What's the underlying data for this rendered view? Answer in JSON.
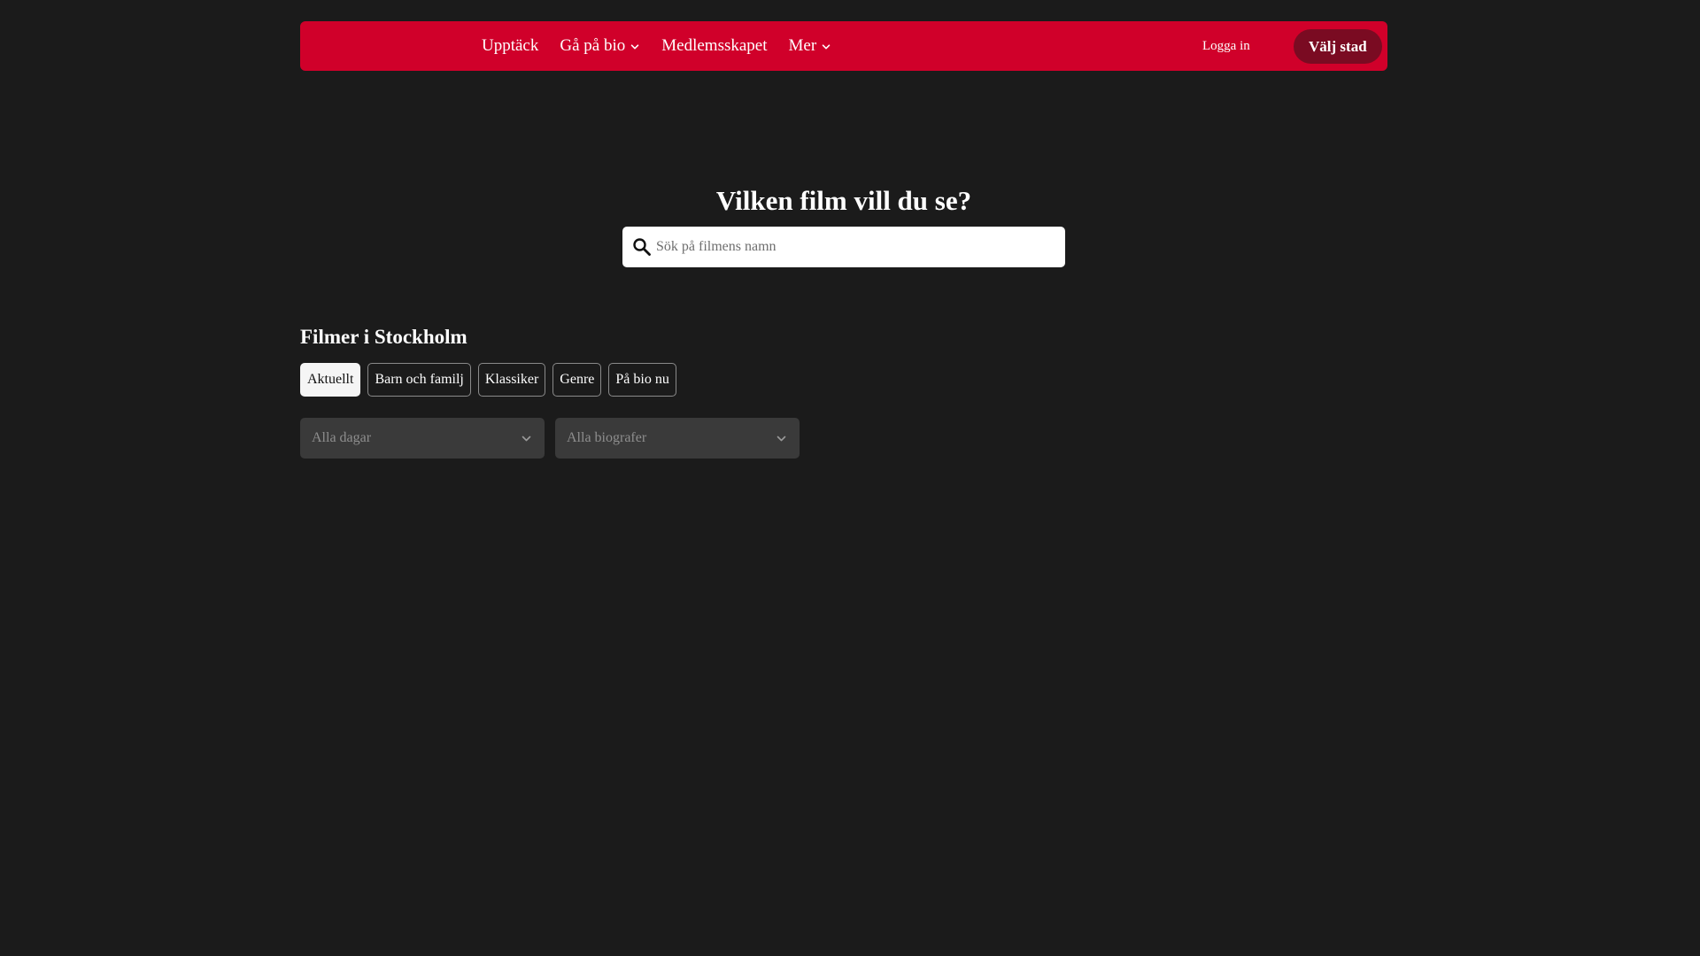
{
  "nav": {
    "items": [
      {
        "label": "Upptäck",
        "has_dropdown": false
      },
      {
        "label": "Gå på bio",
        "has_dropdown": true
      },
      {
        "label": "Medlemsskapet",
        "has_dropdown": false
      },
      {
        "label": "Mer",
        "has_dropdown": true
      }
    ],
    "login_label": "Logga in",
    "city_button_label": "Välj stad"
  },
  "hero": {
    "title": "Vilken film vill du se?",
    "search_placeholder": "Sök på filmens namn",
    "search_value": ""
  },
  "section": {
    "title": "Filmer i Stockholm",
    "tabs": [
      {
        "label": "Aktuellt",
        "active": true
      },
      {
        "label": "Barn och familj",
        "active": false
      },
      {
        "label": "Klassiker",
        "active": false
      },
      {
        "label": "Genre",
        "active": false
      },
      {
        "label": "På bio nu",
        "active": false
      }
    ],
    "filters": {
      "days": {
        "selected": "Alla dagar"
      },
      "cinemas": {
        "selected": "Alla biografer"
      }
    }
  },
  "colors": {
    "brand_red": "#d0002a",
    "city_button": "#7a0b22",
    "page_background": "#1b1b1b",
    "select_background": "#3a3a3a"
  },
  "icons": {
    "search": "search-icon",
    "dropdown": "chevron-down-icon"
  }
}
